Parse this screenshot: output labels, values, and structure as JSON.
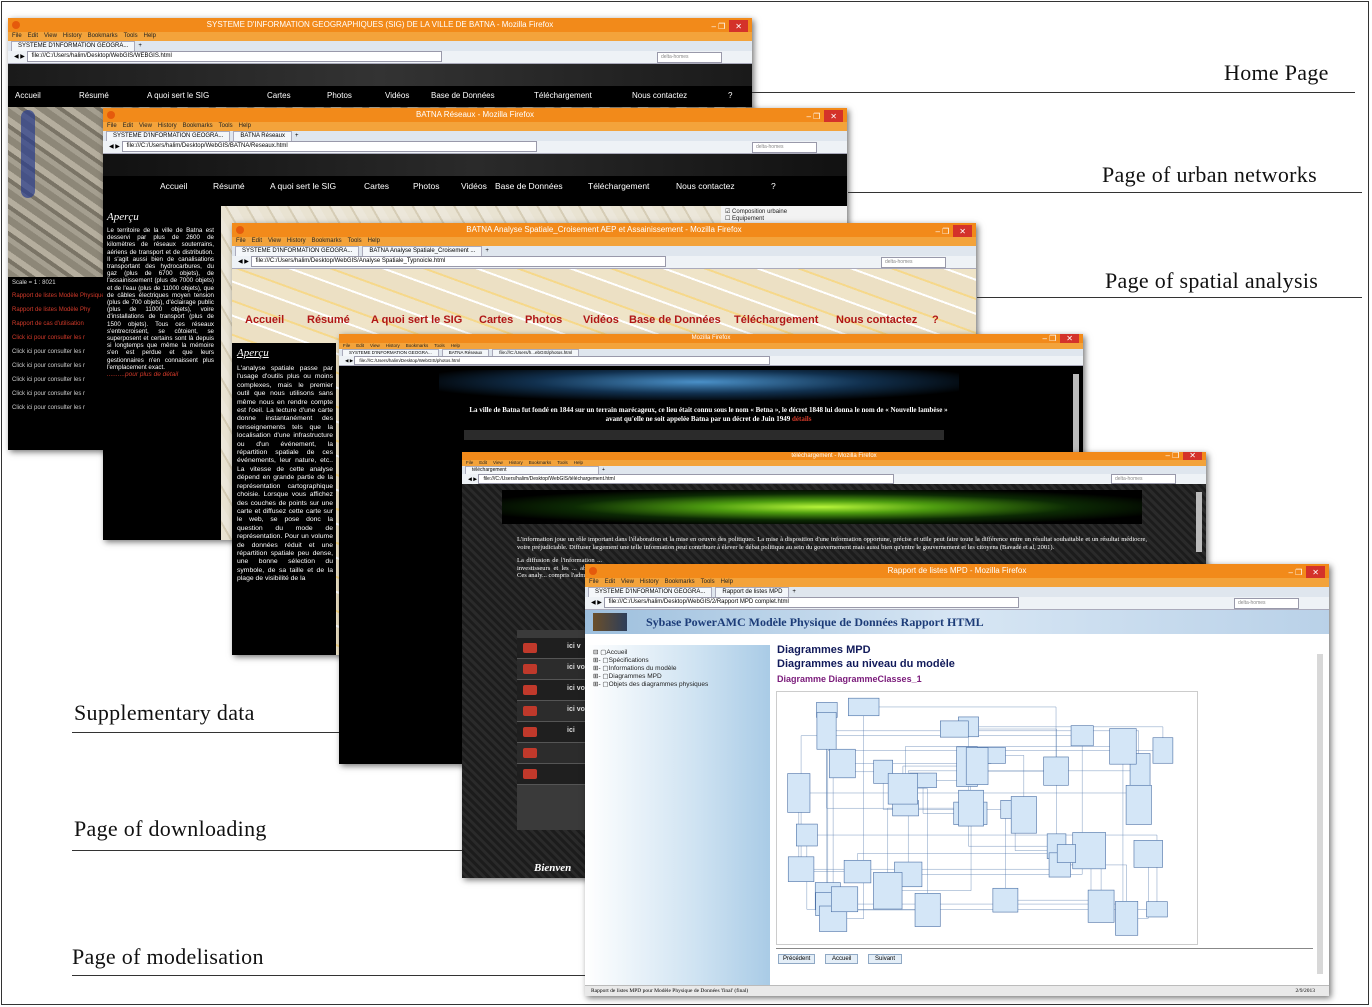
{
  "captions": {
    "home": "Home Page",
    "urban": "Page of urban networks",
    "spatial": "Page of spatial analysis",
    "supplementary": "Supplementary data",
    "downloading": "Page of downloading",
    "modelisation": "Page of modelisation"
  },
  "colors": {
    "titlebar": "#f28a1a",
    "menubar": "#f3a33b",
    "link_red": "#d23a2a"
  },
  "menu": [
    "File",
    "Edit",
    "View",
    "History",
    "Bookmarks",
    "Tools",
    "Help"
  ],
  "site_nav": [
    "Accueil",
    "Résumé",
    "A quoi sert le SIG",
    "Cartes",
    "Photos",
    "Vidéos",
    "Base de Données",
    "Téléchargement",
    "Nous contactez",
    "?"
  ],
  "search_placeholder": "delta-homes",
  "window_home": {
    "title": "SYSTEME D'INFORMATION GEOGRAPHIQUES (SIG) DE LA VILLE DE BATNA - Mozilla Firefox",
    "tab": "SYSTEME D'INFORMATION GEOGRA...",
    "url": "file:///C:/Users/halim/Desktop/WebGIS/WEBGIS.html",
    "scale": "Scale = 1 : 8021",
    "links": [
      "Rapport de listes Modèle Physique",
      "Rapport de listes Modèle Phy",
      "Rapport de cas d'utilisation",
      "Click ici pour consulter les r",
      "Click ici pour consulter les r",
      "Click ici pour consulter les r",
      "Click ici pour consulter les r",
      "Click ici pour consulter les r",
      "Click ici pour consulter les r"
    ]
  },
  "window_urban": {
    "title": "BATNA Réseaux - Mozilla Firefox",
    "tabs": [
      "SYSTEME D'INFORMATION GEOGRA...",
      "BATNA Réseaux"
    ],
    "url": "file:///C:/Users/halim/Desktop/WebGIS/BATNA/Reseaux.html",
    "heading": "Aperçu",
    "body": "Le territoire de la ville de Batna est desservi par plus de 2600 de kilomètres de réseaux souterrains, aériens de transport et de distribution. Il s'agit aussi bien de canalisations transportant des hydrocarbures, du gaz (plus de 6700 objets), de l'assainissement (plus de 7000 objets) et de l'eau (plus de 11000 objets), que de câbles électriques moyen tension (plus de 700 objets), d'éclairage public (plus de 11000 objets), voire d'installations de transport (plus de 1500 objets). Tous ces réseaux s'entrecroisent, se côtoient, se superposent et certains sont là depuis si longtemps que même la mémoire s'en est perdue et que leurs gestionnaires n'en connaissent plus l'emplacement exact.",
    "more": "..........pour plus de détail",
    "layer": "Composition urbaine",
    "layer2": "Equipement"
  },
  "window_spatial": {
    "title": "BATNA Analyse Spatiale_Croisement AEP et Assainissement - Mozilla Firefox",
    "tabs": [
      "SYSTEME D'INFORMATION GEOGRA...",
      "BATNA Analyse Spatiale_Croisement ..."
    ],
    "url": "file:///C:/Users/halim/Desktop/WebGIS/Analyse Spatiale_Typnoicle.html",
    "heading": "Aperçu",
    "body": "L'analyse spatiale passe par l'usage d'outils plus ou moins complexes, mais le premier outil que nous utilisons sans même nous en rendre compte est l'oeil. La lecture d'une carte donne instantanément des renseignements tels que la localisation d'une infrastructure ou d'un événement, la répartition spatiale de ces événements, leur nature, etc.. La vitesse de cette analyse dépend en grande partie de la représentation cartographique choisie. Lorsque vous affichez des couches de points sur une carte et diffusez cette carte sur le web, se pose donc la question du mode de représentation. Pour un volume de données réduit et une répartition spatiale peu dense, une bonne sélection du symbole, de sa taille et de la plage de visibilité de la"
  },
  "window_photos": {
    "title": "Mozilla Firefox",
    "tabs": [
      "SYSTEME D'INFORMATION GEOGRA...",
      "BATNA Réseaux",
      "file:///C:/Users/h...ebGIS/photos.html"
    ],
    "url": "file:///C:/Users/halim/Desktop/WebGIS/photos.html",
    "text": "La ville de Batna fut fondé en 1844 sur un terrain marécageux, ce lieu était connu sous le nom « Betna », le décret 1848 lui donna le nom de « Nouvelle lambèse » avant qu'elle ne soit appelée Batna par un décret de Juin 1949",
    "detail": "détails"
  },
  "window_download": {
    "title": "téléchargement - Mozilla Firefox",
    "tab": "téléchargement",
    "url": "file:///C:/Users/halim/Desktop/WebGIS/téléchargement.html",
    "para1": "L'information joue un rôle important dans l'élaboration et la mise en oeuvre des politiques. La mise à disposition d'une information opportune, précise et utile peut faire toute la différence entre un résultat souhaitable et un résultat médiocre, voire préjudiciable. Diffuser largement une telle information peut contribuer à élever le débat politique au sein du gouvernement mais aussi bien qu'entre le gouvernement et les citoyens (Bavadé et al, 2001).",
    "para2": "La diffusion de l'information ... investisseurs et les ... abordés. Ces analy... compris l'administ...",
    "rows": [
      "ici v",
      "ici vo",
      "ici vou",
      "ici vou",
      "ici",
      "",
      ""
    ],
    "footer": "Bienven"
  },
  "window_model": {
    "title": "Rapport de listes MPD - Mozilla Firefox",
    "tabs": [
      "SYSTEME D'INFORMATION GEOGRA...",
      "Rapport de listes MPD"
    ],
    "url": "file:///C:/Users/halim/Desktop/WebGIS/2/Rapport MPD complet.html",
    "header": "Sybase PowerAMC Modèle Physique de Données Rapport HTML",
    "tree": [
      "Accueil",
      "Spécifications",
      "Informations du modèle",
      "Diagrammes MPD",
      "Objets des diagrammes physiques"
    ],
    "h1": "Diagrammes MPD",
    "h2": "Diagrammes au niveau du modèle",
    "h3": "Diagramme DiagrammeClasses_1",
    "buttons": [
      "Précédent",
      "Accueil",
      "Suivant"
    ],
    "status": "Rapport de listes MPD pour Modèle Physique de Données 'final' (final)",
    "date": "2/9/2013"
  }
}
